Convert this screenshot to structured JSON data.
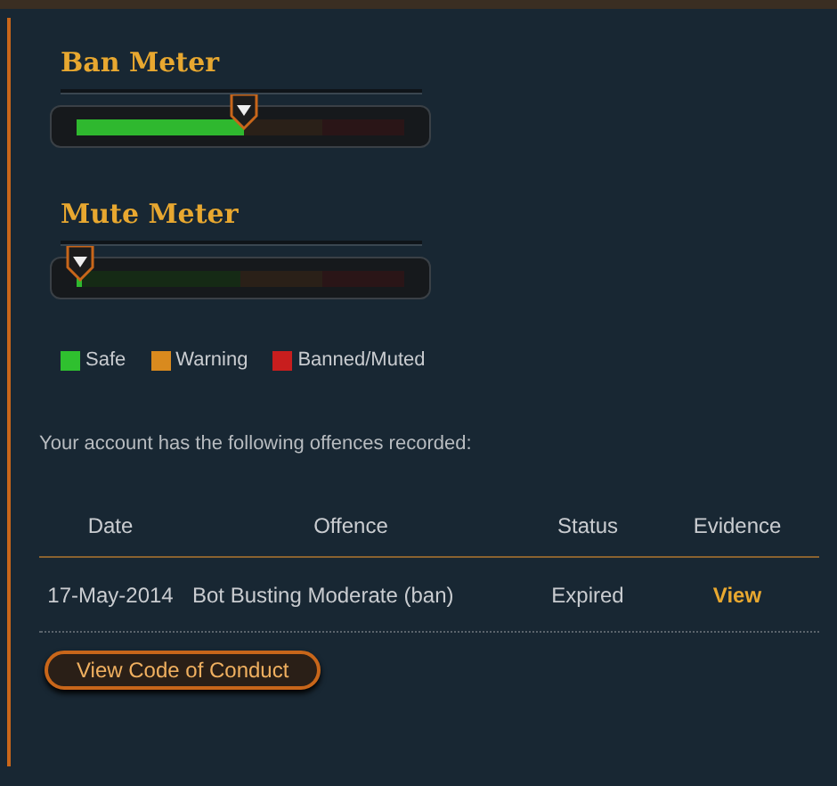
{
  "meters": [
    {
      "title": "Ban Meter",
      "level": 0.51
    },
    {
      "title": "Mute Meter",
      "level": 0.01
    }
  ],
  "legend": [
    {
      "label": "Safe",
      "color": "#2fc02f"
    },
    {
      "label": "Warning",
      "color": "#d98a1e"
    },
    {
      "label": "Banned/Muted",
      "color": "#c81e1e"
    }
  ],
  "intro": "Your account has the following offences recorded:",
  "table": {
    "columns": [
      "Date",
      "Offence",
      "Status",
      "Evidence"
    ],
    "rows": [
      {
        "date": "17-May-2014",
        "offence": "Bot Busting Moderate (ban)",
        "status": "Expired",
        "evidence": "View"
      }
    ]
  },
  "button": "View Code of Conduct"
}
